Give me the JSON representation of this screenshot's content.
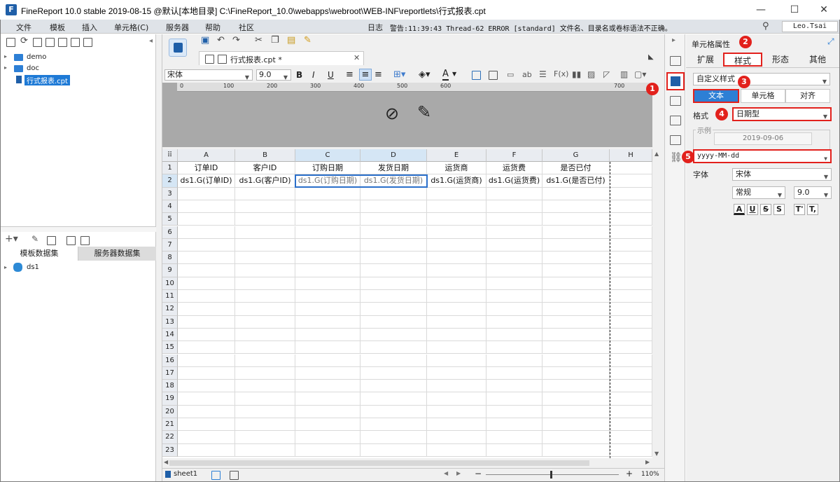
{
  "window": {
    "title": "FineReport 10.0 stable 2019-08-15 @默认[本地目录]    C:\\FineReport_10.0\\webapps\\webroot\\WEB-INF\\reportlets\\行式报表.cpt",
    "minimize": "—",
    "maximize": "☐",
    "close": "✕"
  },
  "menu": {
    "items": [
      "文件",
      "模板",
      "插入",
      "单元格(C)",
      "服务器",
      "帮助",
      "社区"
    ],
    "log_label": "日志",
    "log_message": "警告:11:39:43 Thread-62 ERROR [standard] 文件名、目录名或卷标语法不正确。",
    "user": "Leo.Tsai"
  },
  "left_panel": {
    "tree": [
      {
        "label": "demo",
        "type": "folder"
      },
      {
        "label": "doc",
        "type": "folder"
      },
      {
        "label": "行式报表.cpt",
        "type": "file"
      }
    ],
    "dataset_tabs": [
      "模板数据集",
      "服务器数据集"
    ],
    "datasets": [
      "ds1"
    ]
  },
  "editor": {
    "tab_label": "行式报表.cpt *",
    "font_name": "宋体",
    "font_size": "9.0",
    "ruler_ticks": [
      "0",
      "100",
      "200",
      "300",
      "400",
      "500",
      "600",
      "700"
    ],
    "columns": [
      "A",
      "B",
      "C",
      "D",
      "E",
      "F",
      "G",
      "H"
    ],
    "rows": [
      "1",
      "2",
      "3",
      "4",
      "5",
      "6",
      "7",
      "8",
      "9",
      "10",
      "11",
      "12",
      "13",
      "14",
      "15",
      "16",
      "17",
      "18",
      "19",
      "20",
      "21",
      "22",
      "23"
    ],
    "header_row": [
      "订单ID",
      "客户ID",
      "订购日期",
      "发货日期",
      "运货商",
      "运货费",
      "是否已付"
    ],
    "data_row": [
      "ds1.G(订单ID)",
      "ds1.G(客户ID)",
      "ds1.G(订购日期)",
      "ds1.G(发货日期)",
      "ds1.G(运货商)",
      "ds1.G(运货费)",
      "ds1.G(是否已付)"
    ],
    "sheet_tab": "sheet1",
    "zoom": "110%"
  },
  "right_panel": {
    "title": "单元格属性",
    "tabs": [
      "扩展",
      "样式",
      "形态",
      "其他"
    ],
    "style_mode": "自定义样式",
    "subtabs": [
      "文本",
      "单元格",
      "对齐"
    ],
    "format_label": "格式",
    "format_value": "日期型",
    "example_label": "示例",
    "example_value": "2019-09-06",
    "pattern_value": "yyyy-MM-dd",
    "font_label": "字体",
    "font_value": "宋体",
    "font_style": "常规",
    "font_size": "9.0",
    "badges": [
      "1",
      "2",
      "3",
      "4",
      "5"
    ]
  }
}
